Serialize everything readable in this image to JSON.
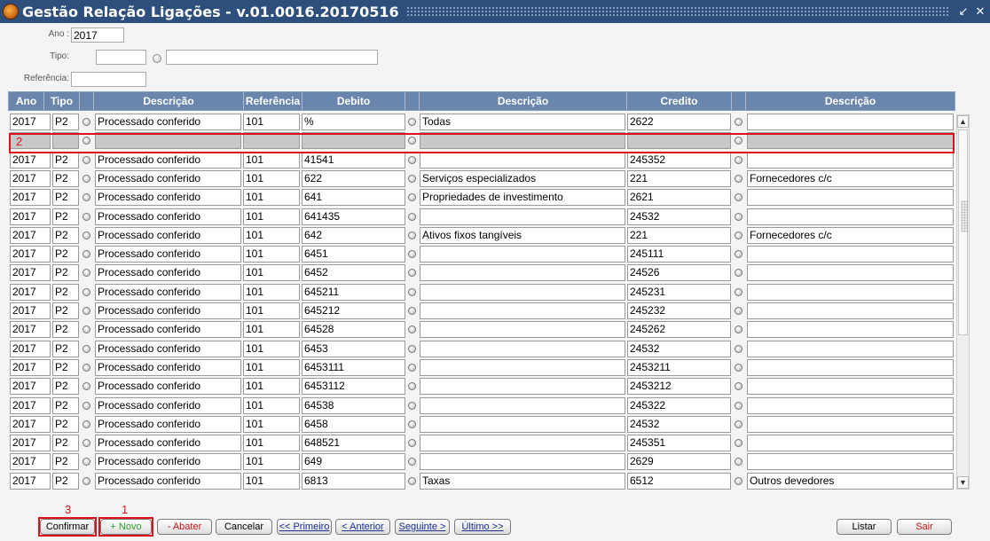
{
  "window": {
    "title": "Gestão Relação Ligações - v.01.0016.20170516",
    "minimize": "↙",
    "close": "✕"
  },
  "filters": {
    "ano_label": "Ano :",
    "ano_value": "2017",
    "tipo_label": "Tipo:",
    "tipo_value": "",
    "tipo_desc": "",
    "ref_label": "Referência:",
    "ref_value": ""
  },
  "columns": [
    "Ano",
    "Tipo",
    "Descrição",
    "Referência",
    "Debito",
    "Descrição",
    "Credito",
    "Descrição"
  ],
  "rows": [
    {
      "ano": "2017",
      "tipo": "P2",
      "desc": "Processado conferido",
      "ref": "101",
      "deb": "%",
      "deb_desc": "Todas",
      "cred": "2622",
      "cred_desc": ""
    },
    {
      "ano": "",
      "tipo": "",
      "desc": "",
      "ref": "",
      "deb": "",
      "deb_desc": "",
      "cred": "",
      "cred_desc": "",
      "empty": true
    },
    {
      "ano": "2017",
      "tipo": "P2",
      "desc": "Processado conferido",
      "ref": "101",
      "deb": "41541",
      "deb_desc": "",
      "cred": "245352",
      "cred_desc": ""
    },
    {
      "ano": "2017",
      "tipo": "P2",
      "desc": "Processado conferido",
      "ref": "101",
      "deb": "622",
      "deb_desc": "Serviços especializados",
      "cred": "221",
      "cred_desc": "Fornecedores c/c"
    },
    {
      "ano": "2017",
      "tipo": "P2",
      "desc": "Processado conferido",
      "ref": "101",
      "deb": "641",
      "deb_desc": "Propriedades de investimento",
      "cred": "2621",
      "cred_desc": ""
    },
    {
      "ano": "2017",
      "tipo": "P2",
      "desc": "Processado conferido",
      "ref": "101",
      "deb": "641435",
      "deb_desc": "",
      "cred": "24532",
      "cred_desc": ""
    },
    {
      "ano": "2017",
      "tipo": "P2",
      "desc": "Processado conferido",
      "ref": "101",
      "deb": "642",
      "deb_desc": "Ativos fixos tangíveis",
      "cred": "221",
      "cred_desc": "Fornecedores c/c"
    },
    {
      "ano": "2017",
      "tipo": "P2",
      "desc": "Processado conferido",
      "ref": "101",
      "deb": "6451",
      "deb_desc": "",
      "cred": "245111",
      "cred_desc": ""
    },
    {
      "ano": "2017",
      "tipo": "P2",
      "desc": "Processado conferido",
      "ref": "101",
      "deb": "6452",
      "deb_desc": "",
      "cred": "24526",
      "cred_desc": ""
    },
    {
      "ano": "2017",
      "tipo": "P2",
      "desc": "Processado conferido",
      "ref": "101",
      "deb": "645211",
      "deb_desc": "",
      "cred": "245231",
      "cred_desc": ""
    },
    {
      "ano": "2017",
      "tipo": "P2",
      "desc": "Processado conferido",
      "ref": "101",
      "deb": "645212",
      "deb_desc": "",
      "cred": "245232",
      "cred_desc": ""
    },
    {
      "ano": "2017",
      "tipo": "P2",
      "desc": "Processado conferido",
      "ref": "101",
      "deb": "64528",
      "deb_desc": "",
      "cred": "245262",
      "cred_desc": ""
    },
    {
      "ano": "2017",
      "tipo": "P2",
      "desc": "Processado conferido",
      "ref": "101",
      "deb": "6453",
      "deb_desc": "",
      "cred": "24532",
      "cred_desc": ""
    },
    {
      "ano": "2017",
      "tipo": "P2",
      "desc": "Processado conferido",
      "ref": "101",
      "deb": "6453111",
      "deb_desc": "",
      "cred": "2453211",
      "cred_desc": ""
    },
    {
      "ano": "2017",
      "tipo": "P2",
      "desc": "Processado conferido",
      "ref": "101",
      "deb": "6453112",
      "deb_desc": "",
      "cred": "2453212",
      "cred_desc": ""
    },
    {
      "ano": "2017",
      "tipo": "P2",
      "desc": "Processado conferido",
      "ref": "101",
      "deb": "64538",
      "deb_desc": "",
      "cred": "245322",
      "cred_desc": ""
    },
    {
      "ano": "2017",
      "tipo": "P2",
      "desc": "Processado conferido",
      "ref": "101",
      "deb": "6458",
      "deb_desc": "",
      "cred": "24532",
      "cred_desc": ""
    },
    {
      "ano": "2017",
      "tipo": "P2",
      "desc": "Processado conferido",
      "ref": "101",
      "deb": "648521",
      "deb_desc": "",
      "cred": "245351",
      "cred_desc": ""
    },
    {
      "ano": "2017",
      "tipo": "P2",
      "desc": "Processado conferido",
      "ref": "101",
      "deb": "649",
      "deb_desc": "",
      "cred": "2629",
      "cred_desc": ""
    },
    {
      "ano": "2017",
      "tipo": "P2",
      "desc": "Processado conferido",
      "ref": "101",
      "deb": "6813",
      "deb_desc": "Taxas",
      "cred": "6512",
      "cred_desc": "Outros devedores"
    }
  ],
  "annotations": {
    "new_row": "2",
    "novo": "1",
    "confirmar": "3"
  },
  "buttons": {
    "confirmar": "Confirmar",
    "novo": "+ Novo",
    "abater": "- Abater",
    "cancelar": "Cancelar",
    "primeiro": "<< Primeiro",
    "anterior": "< Anterior",
    "seguinte": "Seguinte >",
    "ultimo": "Último >>",
    "listar": "Listar",
    "sair": "Sair"
  },
  "scrollbar": {
    "up": "▲",
    "down": "▼"
  },
  "colors": {
    "titlebar": "#2e4f7c",
    "header": "#6b86ad",
    "highlight": "#e0101a"
  }
}
